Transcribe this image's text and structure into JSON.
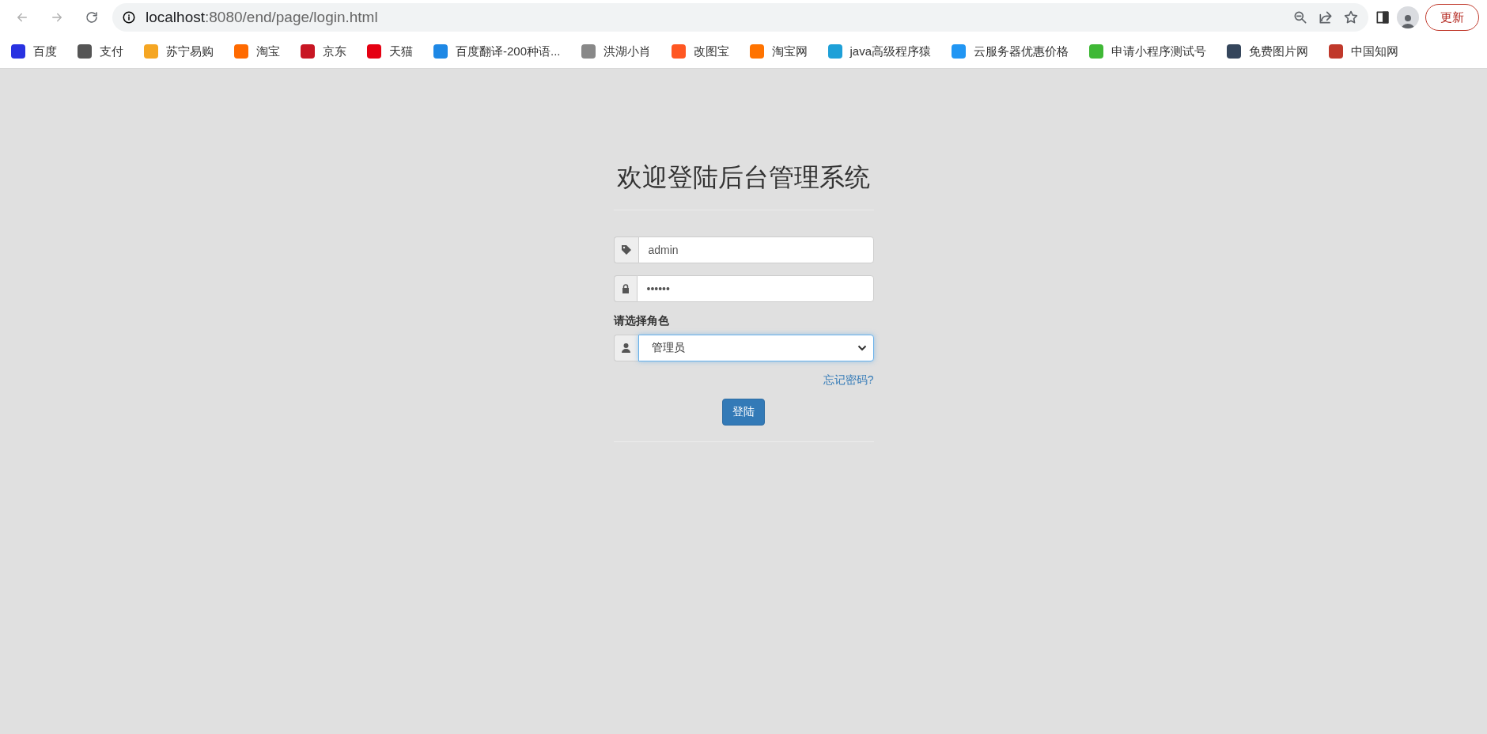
{
  "browser": {
    "address": {
      "host": "localhost",
      "rest": ":8080/end/page/login.html"
    },
    "update_button": "更新",
    "bookmarks": [
      {
        "label": "百度",
        "color": "#2932e1"
      },
      {
        "label": "支付",
        "color": "#555555"
      },
      {
        "label": "苏宁易购",
        "color": "#f5a623"
      },
      {
        "label": "淘宝",
        "color": "#ff6a00"
      },
      {
        "label": "京东",
        "color": "#c81623"
      },
      {
        "label": "天猫",
        "color": "#e50012"
      },
      {
        "label": "百度翻译-200种语...",
        "color": "#1e88e5"
      },
      {
        "label": "洪湖小肖",
        "color": "#888888"
      },
      {
        "label": "改图宝",
        "color": "#ff5722"
      },
      {
        "label": "淘宝网",
        "color": "#ff7300"
      },
      {
        "label": "java高级程序猿",
        "color": "#1ea0d8"
      },
      {
        "label": "云服务器优惠价格",
        "color": "#2196f3"
      },
      {
        "label": "申请小程序测试号",
        "color": "#3fb836"
      },
      {
        "label": "免费图片网",
        "color": "#35465c"
      },
      {
        "label": "中国知网",
        "color": "#c0392b"
      }
    ]
  },
  "login": {
    "title": "欢迎登陆后台管理系统",
    "username": {
      "value": "admin"
    },
    "password": {
      "value": "••••••"
    },
    "role_label": "请选择角色",
    "role_select": {
      "value": "管理员",
      "focused": true
    },
    "forgot_link": "忘记密码?",
    "submit": "登陆"
  }
}
